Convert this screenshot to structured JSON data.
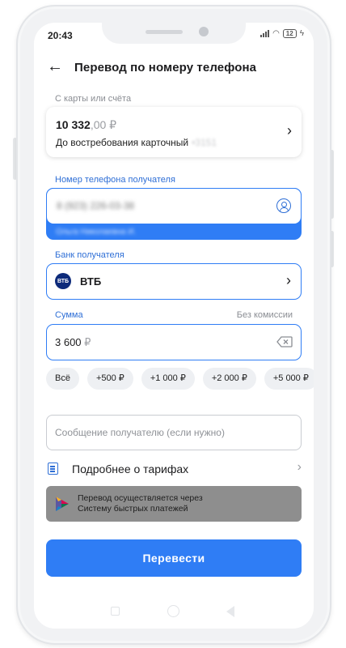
{
  "status_bar": {
    "time": "20:43",
    "battery": "12"
  },
  "header": {
    "title": "Перевод по номеру телефона"
  },
  "source": {
    "label": "С карты или счёта",
    "balance_int": "10 332",
    "balance_dec": ",00 ₽",
    "account_name": "До востребования карточный",
    "account_mask": "•3151"
  },
  "phone": {
    "label": "Номер телефона получателя",
    "value": "8 (923) 226-03-38",
    "owner": "Ольга Николаевна И."
  },
  "bank": {
    "label": "Банк получателя",
    "logo_text": "ВТБ",
    "name": "ВТБ"
  },
  "amount": {
    "label": "Сумма",
    "commission": "Без комиссии",
    "value": "3 600",
    "currency": "₽"
  },
  "quick_amounts": [
    "Всё",
    "+500 ₽",
    "+1 000 ₽",
    "+2 000 ₽",
    "+5 000 ₽"
  ],
  "message": {
    "placeholder": "Сообщение получателю (если нужно)"
  },
  "tariffs": {
    "label": "Подробнее о тарифах"
  },
  "sbp": {
    "line1": "Перевод осуществляется через",
    "line2": "Систему быстрых платежей"
  },
  "submit": {
    "label": "Перевести"
  },
  "colors": {
    "accent": "#2f7df5",
    "banner": "#8e8e8e"
  },
  "icons": [
    "back-arrow-icon",
    "chevron-right-icon",
    "contact-icon",
    "clear-input-icon",
    "document-icon",
    "sbp-logo-icon"
  ]
}
